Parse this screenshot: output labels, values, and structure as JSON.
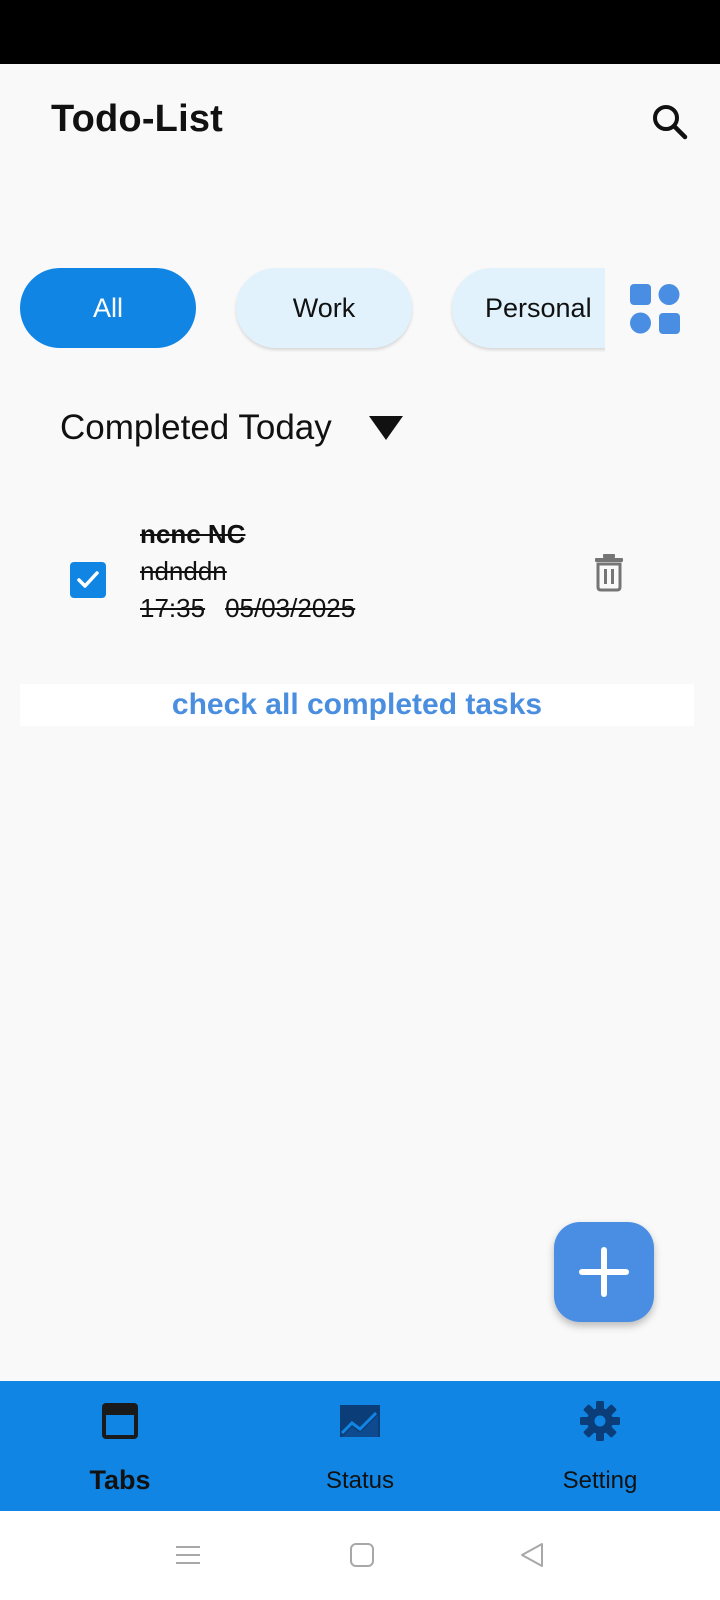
{
  "app": {
    "title": "Todo-List"
  },
  "icons": {
    "search": "search-icon",
    "grid": "grid-view-icon",
    "dropdown": "dropdown-arrow-icon",
    "delete": "trash-icon",
    "add": "plus-icon"
  },
  "filters": {
    "all": "All",
    "work": "Work",
    "personal": "Personal",
    "selected": "All"
  },
  "section": {
    "title": "Completed Today",
    "expanded": true
  },
  "tasks": [
    {
      "title": "ncnc NC",
      "description": "ndnddn",
      "time": "17:35",
      "date": "05/03/2025",
      "completed": true
    }
  ],
  "check_all_link": "check all completed tasks",
  "bottom_nav": {
    "tabs": {
      "label": "Tabs",
      "icon": "tabs-icon",
      "active": true
    },
    "status": {
      "label": "Status",
      "icon": "chart-icon",
      "active": false
    },
    "setting": {
      "label": "Setting",
      "icon": "gear-icon",
      "active": false
    }
  },
  "colors": {
    "primary": "#1185e4",
    "chip_light": "#e1f2fc",
    "fab": "#4a8ee4",
    "link": "#4a8ee0",
    "background": "#f9f9f9"
  }
}
